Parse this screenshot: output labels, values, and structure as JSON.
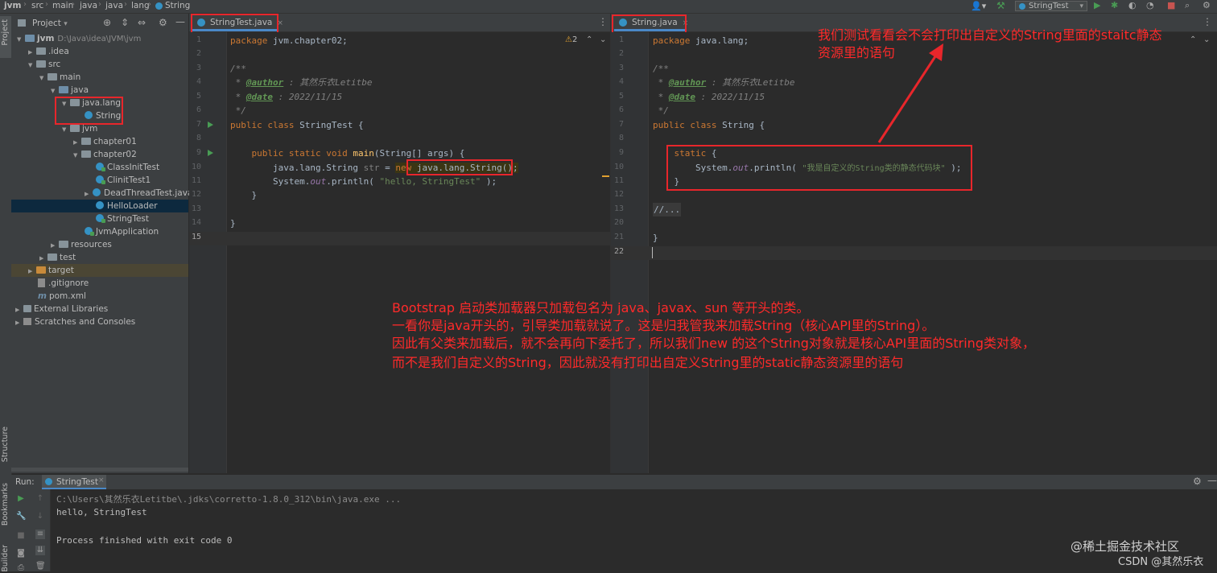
{
  "navbar": {
    "breadcrumbs": [
      "jvm",
      "src",
      "main",
      "java",
      "java",
      "lang",
      "String"
    ],
    "run_config": "StringTest"
  },
  "left_strip": {
    "project": "Project",
    "structure": "Structure",
    "bookmarks": "Bookmarks",
    "builder": "Builder"
  },
  "project_panel": {
    "title": "Project",
    "tree": [
      {
        "label": "jvm",
        "extra": "D:\\Java\\idea\\JVM\\jvm"
      },
      {
        "label": ".idea"
      },
      {
        "label": "src"
      },
      {
        "label": "main"
      },
      {
        "label": "java"
      },
      {
        "label": "java.lang"
      },
      {
        "label": "String"
      },
      {
        "label": "jvm"
      },
      {
        "label": "chapter01"
      },
      {
        "label": "chapter02"
      },
      {
        "label": "ClassInitTest"
      },
      {
        "label": "ClinitTest1"
      },
      {
        "label": "DeadThreadTest.java"
      },
      {
        "label": "HelloLoader"
      },
      {
        "label": "StringTest"
      },
      {
        "label": "JvmApplication"
      },
      {
        "label": "resources"
      },
      {
        "label": "test"
      },
      {
        "label": "target"
      },
      {
        "label": ".gitignore"
      },
      {
        "label": "pom.xml"
      },
      {
        "label": "External Libraries"
      },
      {
        "label": "Scratches and Consoles"
      }
    ]
  },
  "editor_left": {
    "tab": "StringTest.java",
    "warnings": "2",
    "line_numbers": [
      "1",
      "2",
      "3",
      "4",
      "5",
      "6",
      "7",
      "8",
      "9",
      "10",
      "11",
      "12",
      "13",
      "14",
      "15"
    ],
    "lines": {
      "l1_kw": "package",
      "l1_rest": " jvm.chapter02;",
      "l3": "/**",
      "l4_star": " * ",
      "l4_tag": "@author",
      "l4_text": " : 其然乐衣Letitbe",
      "l5_star": " * ",
      "l5_tag": "@date",
      "l5_text": " : 2022/11/15",
      "l6": " */",
      "l7_kw": "public class",
      "l7_rest": " StringTest {",
      "l9_kw": "    public static void",
      "l9_fn": " main",
      "l9_rest": "(String[] args) {",
      "l10_a": "        java.lang.String ",
      "l10_var": "str",
      "l10_b": " = ",
      "l10_kw": "new",
      "l10_c": " java.lang.String();",
      "l11_a": "        System.",
      "l11_out": "out",
      "l11_b": ".println( ",
      "l11_str": "\"hello, StringTest\"",
      "l11_c": " );",
      "l12": "    }",
      "l14": "}"
    }
  },
  "editor_right": {
    "tab": "String.java",
    "line_numbers": [
      "1",
      "2",
      "3",
      "4",
      "5",
      "6",
      "7",
      "8",
      "9",
      "10",
      "11",
      "12",
      "13",
      "20",
      "21",
      "22"
    ],
    "lines": {
      "l1_kw": "package",
      "l1_rest": " java.lang;",
      "l3": "/**",
      "l4_star": " * ",
      "l4_tag": "@author",
      "l4_text": " : 其然乐衣Letitbe",
      "l5_star": " * ",
      "l5_tag": "@date",
      "l5_text": " : 2022/11/15",
      "l6": " */",
      "l7_kw": "public class",
      "l7_rest": " String {",
      "l9_kw": "    static",
      "l9_rest": " {",
      "l10_a": "        System.",
      "l10_out": "out",
      "l10_b": ".println( ",
      "l10_str": "\"我是自定义的String类的静态代码块\"",
      "l10_c": " );",
      "l11": "    }",
      "l13": "//...",
      "l21": "}"
    }
  },
  "annotations": {
    "top_right": [
      "我们测试看看会不会打印出自定义的String里面的staitc静态",
      "资源里的语句"
    ],
    "center": [
      "Bootstrap 启动类加载器只加载包名为 java、javax、sun 等开头的类。",
      "一看你是java开头的，引导类加载就说了。这是归我管我来加载String（核心API里的String）。",
      "因此有父类来加载后，就不会再向下委托了，所以我们new 的这个String对象就是核心API里面的String类对象，",
      "而不是我们自定义的String，因此就没有打印出自定义String里的static静态资源里的语句"
    ]
  },
  "run_panel": {
    "label": "Run:",
    "tab": "StringTest",
    "console": [
      "C:\\Users\\其然乐衣Letitbe\\.jdks\\corretto-1.8.0_312\\bin\\java.exe ...",
      "hello, StringTest",
      "",
      "Process finished with exit code 0"
    ]
  },
  "watermark": {
    "line1": "@稀土掘金技术社区",
    "line2": "CSDN @其然乐衣"
  },
  "colors": {
    "annotation_red": "#e8262b",
    "bg_editor": "#2b2b2b",
    "bg_panel": "#3c3f41",
    "accent_blue": "#4a88c7"
  }
}
